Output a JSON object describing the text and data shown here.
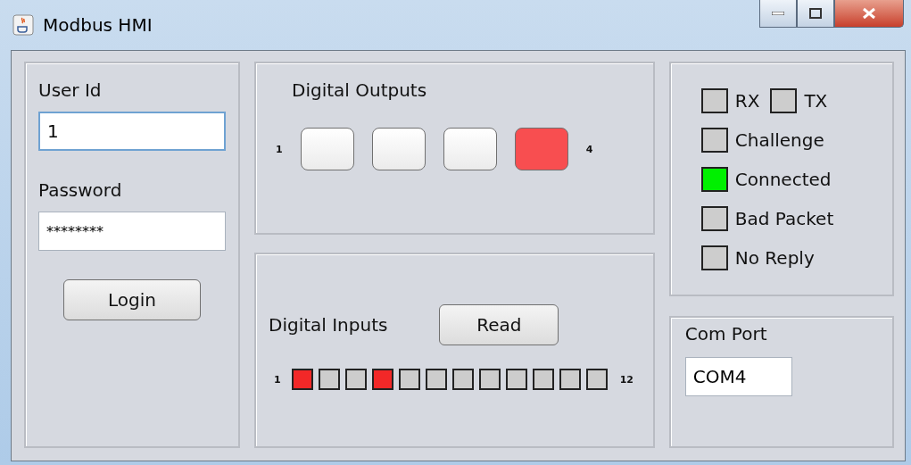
{
  "window": {
    "title": "Modbus HMI"
  },
  "login": {
    "user_id_label": "User Id",
    "user_id_value": "1",
    "password_label": "Password",
    "password_value": "********",
    "login_button": "Login"
  },
  "digital_outputs": {
    "title": "Digital Outputs",
    "first_label": "1",
    "last_label": "4",
    "outputs": [
      {
        "on": false
      },
      {
        "on": false
      },
      {
        "on": false
      },
      {
        "on": true
      }
    ]
  },
  "digital_inputs": {
    "title": "Digital Inputs",
    "read_button": "Read",
    "first_label": "1",
    "last_label": "12",
    "inputs": [
      {
        "on": true
      },
      {
        "on": false
      },
      {
        "on": false
      },
      {
        "on": true
      },
      {
        "on": false
      },
      {
        "on": false
      },
      {
        "on": false
      },
      {
        "on": false
      },
      {
        "on": false
      },
      {
        "on": false
      },
      {
        "on": false
      },
      {
        "on": false
      }
    ]
  },
  "status_rows": [
    [
      {
        "label": "RX",
        "on": false
      },
      {
        "label": "TX",
        "on": false
      }
    ],
    [
      {
        "label": "Challenge",
        "on": false
      }
    ],
    [
      {
        "label": "Connected",
        "on": true
      }
    ],
    [
      {
        "label": "Bad Packet",
        "on": false
      }
    ],
    [
      {
        "label": "No Reply",
        "on": false
      }
    ]
  ],
  "com_port": {
    "label": "Com Port",
    "value": "COM4"
  }
}
